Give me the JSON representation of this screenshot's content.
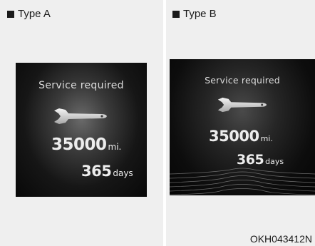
{
  "panels": [
    {
      "label": "Type A",
      "screen": {
        "title": "Service required",
        "distance_value": "35000",
        "distance_unit": "mi.",
        "days_value": "365",
        "days_unit": "days",
        "icon": "wrench-icon"
      }
    },
    {
      "label": "Type B",
      "screen": {
        "title": "Service required",
        "distance_value": "35000",
        "distance_unit": "mi.",
        "days_value": "365",
        "days_unit": "days",
        "icon": "wrench-icon"
      }
    }
  ],
  "figure_code": "OKH043412N",
  "colors": {
    "panel_background": "#efefef",
    "screen_text": "#ededed",
    "label_text": "#1a1a1a"
  }
}
